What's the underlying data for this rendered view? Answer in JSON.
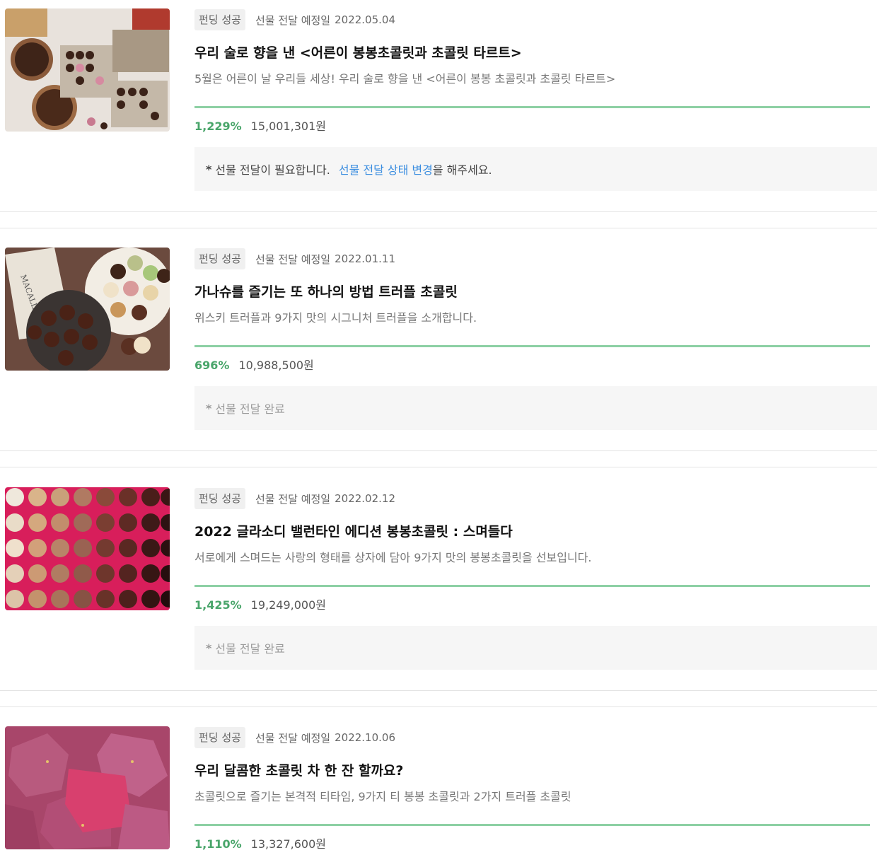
{
  "items": [
    {
      "badge": "펀딩 성공",
      "ship_label": "선물 전달 예정일",
      "ship_date": "2022.05.04",
      "title": "우리 술로 향을 낸 <어른이 봉봉초콜릿과 초콜릿 타르트>",
      "desc": "5월은 어른이 날 우리들 세상! 우리 술로 향을 낸 <어른이 봉봉 초콜릿과 초콜릿 타르트>",
      "percent": "1,229%",
      "amount": "15,001,301원",
      "progress": 1,
      "notice_star": "*",
      "notice_text": "선물 전달이 필요합니다.",
      "notice_link": "선물 전달 상태 변경",
      "notice_suffix": "을 해주세요."
    },
    {
      "badge": "펀딩 성공",
      "ship_label": "선물 전달 예정일",
      "ship_date": "2022.01.11",
      "title": "가나슈를 즐기는 또 하나의 방법 트러플 초콜릿",
      "desc": "위스키 트러플과 9가지 맛의 시그니처 트러플을 소개합니다.",
      "percent": "696%",
      "amount": "10,988,500원",
      "progress": 1,
      "notice_star": "*",
      "notice_text": "선물 전달 완료"
    },
    {
      "badge": "펀딩 성공",
      "ship_label": "선물 전달 예정일",
      "ship_date": "2022.02.12",
      "title": "2022 글라소디 밸런타인 에디션 봉봉초콜릿 : 스며들다",
      "desc": "서로에게 스며드는 사랑의 형태를 상자에 담아 9가지 맛의 봉봉초콜릿을 선보입니다.",
      "percent": "1,425%",
      "amount": "19,249,000원",
      "progress": 1,
      "notice_star": "*",
      "notice_text": "선물 전달 완료"
    },
    {
      "badge": "펀딩 성공",
      "ship_label": "선물 전달 예정일",
      "ship_date": "2022.10.06",
      "title": "우리 달콤한 초콜릿 차 한 잔 할까요?",
      "desc": "초콜릿으로 즐기는 본격적 티타임, 9가지 티 봉봉 초콜릿과 2가지 트러플 초콜릿",
      "percent": "1,110%",
      "amount": "13,327,600원",
      "progress": 1
    }
  ],
  "colors": {
    "accent": "#49a56a",
    "bar": "#8dd0a4",
    "link": "#3a8de0"
  }
}
